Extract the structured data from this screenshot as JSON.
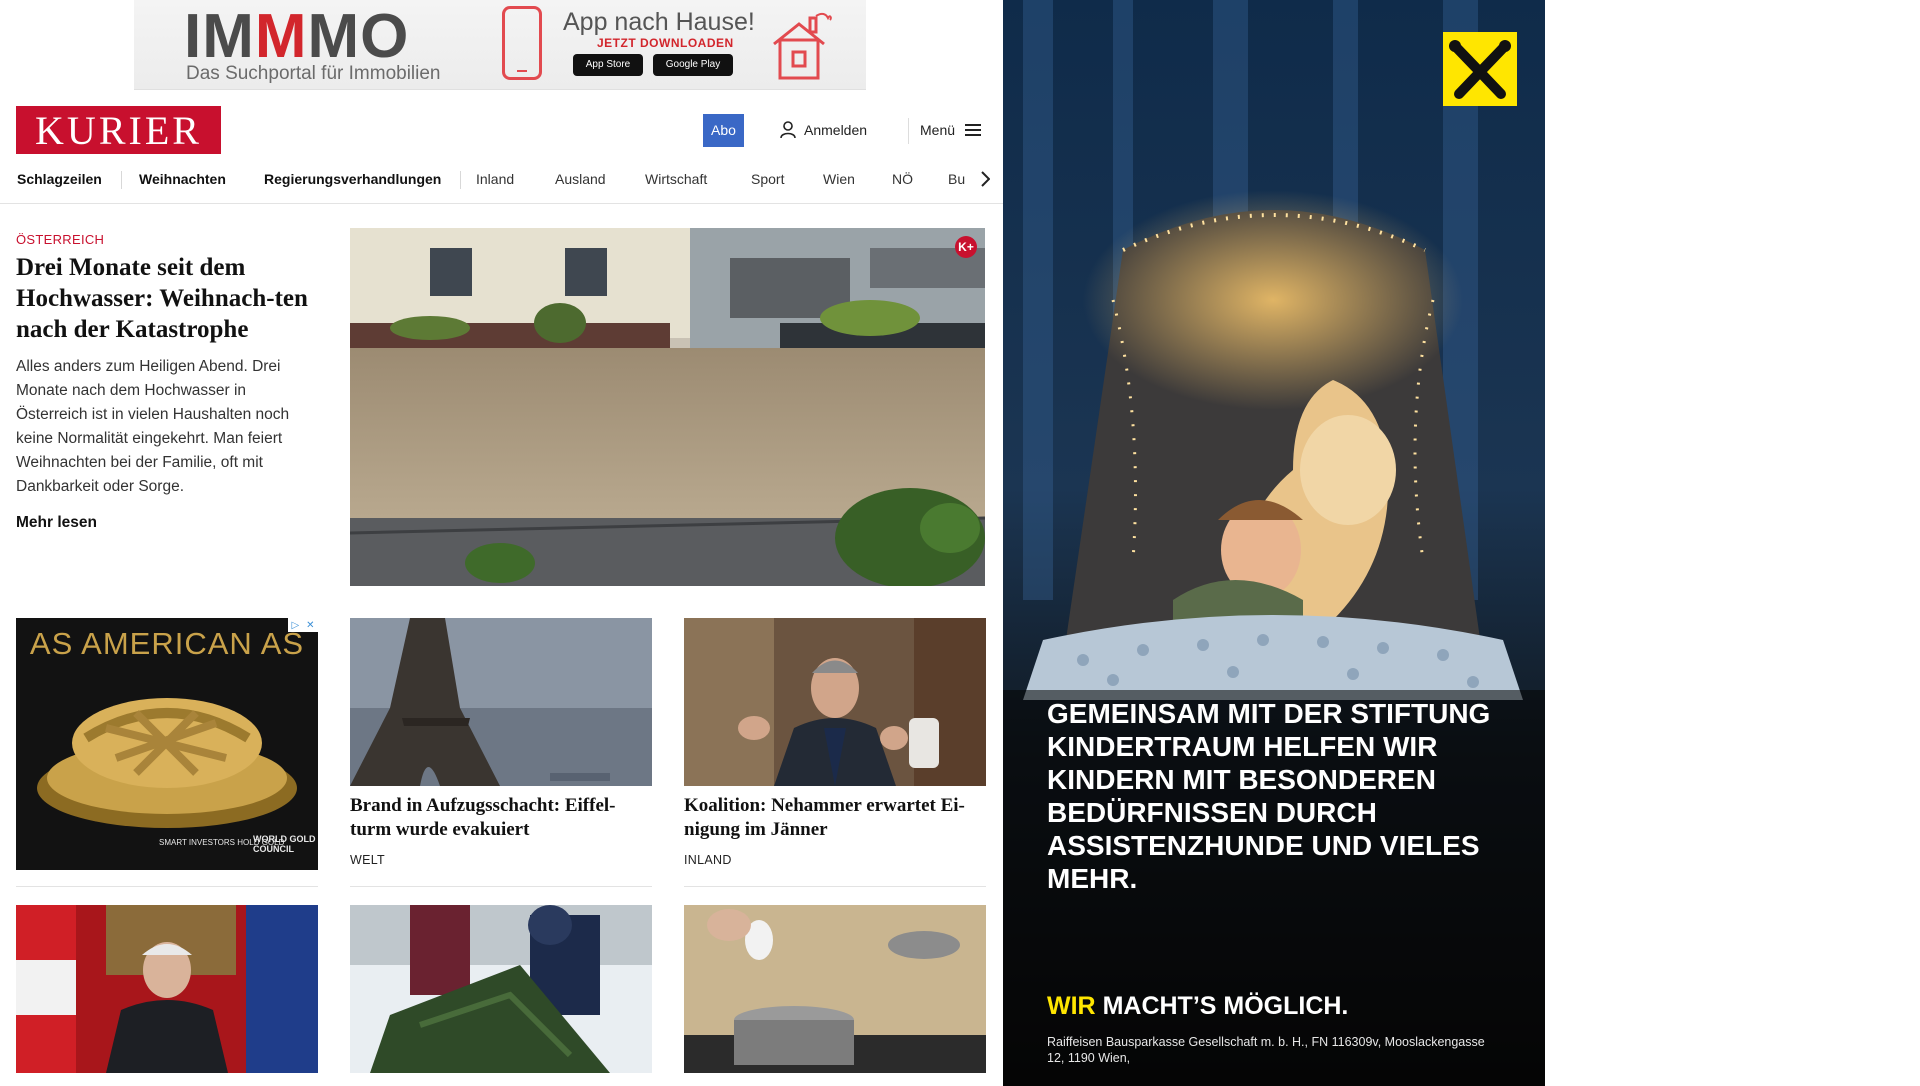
{
  "top_ad": {
    "brand_prefix": "IM",
    "brand_red": "M",
    "brand_suffix": "MO",
    "tagline": "Das Suchportal für Immobilien",
    "title": "App nach Hause!",
    "cta": "JETZT DOWNLOADEN",
    "app_store": "App Store",
    "google_play": "Google Play"
  },
  "header": {
    "logo": "KURIER",
    "abo": "Abo",
    "login": "Anmelden",
    "menu": "Menü"
  },
  "nav": [
    "Schlagzeilen",
    "Weihnachten",
    "Regierungsverhandlungen",
    "Inland",
    "Ausland",
    "Wirtschaft",
    "Sport",
    "Wien",
    "NÖ",
    "Bu"
  ],
  "lead": {
    "kicker": "Österreich",
    "headline": "Drei Monate seit dem Hochwasser: Weihnach-ten nach der Katastrophe",
    "text": "Alles anders zum Heiligen Abend. Drei Monate nach dem Hochwasser in Österreich ist in vielen Haushalten noch keine Normalität eingekehrt. Man feiert Weihnachten bei der Familie, oft mit Dankbarkeit oder Sorge.",
    "more": "Mehr lesen",
    "badge": "K+"
  },
  "pie_ad": {
    "title": "AS AMERICAN AS",
    "tagline": "SMART INVESTORS HOLD GOLD",
    "brand": "WORLD GOLD COUNCIL"
  },
  "cards": [
    {
      "title": "Brand in Aufzugsschacht: Eiffel-turm wurde evakuiert",
      "category": "Welt"
    },
    {
      "title": "Koalition: Nehammer erwartet Ei-nigung im Jänner",
      "category": "Inland"
    }
  ],
  "side_ad": {
    "text": "Gemeinsam mit der Stiftung Kindertraum helfen wir Kindern mit besonderen Bedürfnissen durch Assistenzhunde und vieles mehr.",
    "slogan_yellow": "WIR",
    "slogan_white": "MACHT’S MÖGLICH.",
    "legal": "Raiffeisen Bausparkasse Gesellschaft m. b. H., FN 116309v, Mooslackengasse 12, 1190 Wien,"
  },
  "colors": {
    "brand_red": "#c8102e",
    "abo_blue": "#3a68c6",
    "raiffeisen_yellow": "#ffe600"
  }
}
